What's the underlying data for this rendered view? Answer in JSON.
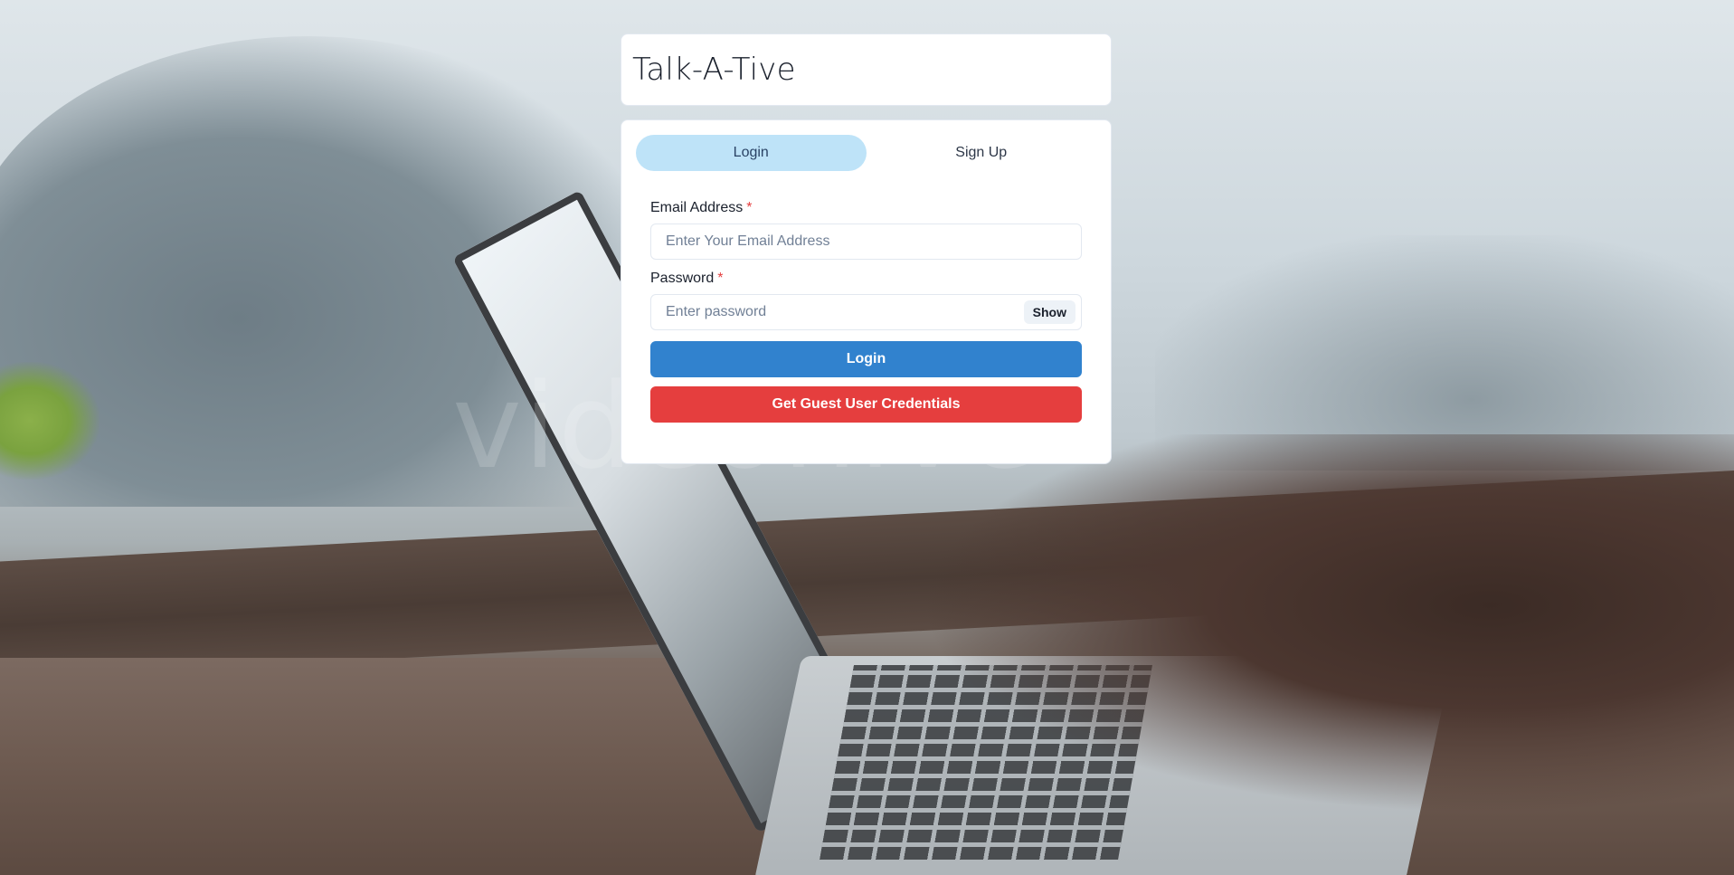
{
  "app": {
    "title": "Talk-A-Tive"
  },
  "background": {
    "watermark": "videohive"
  },
  "tabs": [
    {
      "label": "Login",
      "active": true
    },
    {
      "label": "Sign Up",
      "active": false
    }
  ],
  "form": {
    "email": {
      "label": "Email Address",
      "required_mark": "*",
      "placeholder": "Enter Your Email Address",
      "value": ""
    },
    "password": {
      "label": "Password",
      "required_mark": "*",
      "placeholder": "Enter password",
      "value": "",
      "toggle_label": "Show"
    },
    "submit_label": "Login",
    "guest_label": "Get Guest User Credentials"
  },
  "colors": {
    "primary": "#3182ce",
    "danger": "#e53e3e",
    "tab_active": "#bee3f8"
  }
}
